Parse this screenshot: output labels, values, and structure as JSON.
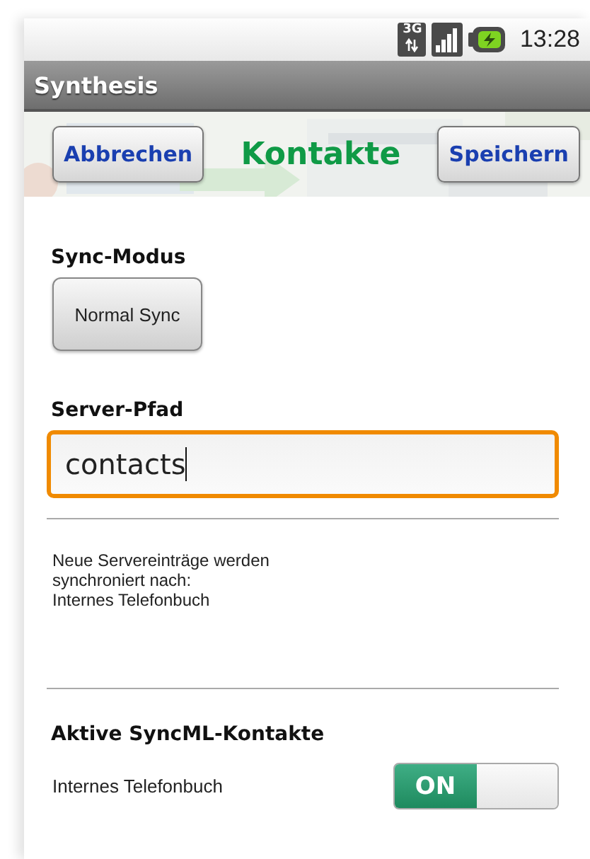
{
  "status_bar": {
    "network_label": "3G",
    "time": "13:28"
  },
  "app_bar": {
    "title": "Synthesis"
  },
  "header": {
    "cancel_button": "Abbrechen",
    "title": "Kontakte",
    "save_button": "Speichern"
  },
  "sync_mode": {
    "label": "Sync-Modus",
    "value": "Normal Sync"
  },
  "server_path": {
    "label": "Server-Pfad",
    "value": "contacts",
    "focused": true
  },
  "note": {
    "lines": [
      "Neue Servereinträge werden",
      "synchroniert nach:",
      "Internes Telefonbuch"
    ]
  },
  "contacts_section": {
    "title": "Aktive SyncML-Kontakte",
    "items": [
      {
        "label": "Internes Telefonbuch",
        "on": true,
        "state_text": "ON"
      }
    ]
  }
}
